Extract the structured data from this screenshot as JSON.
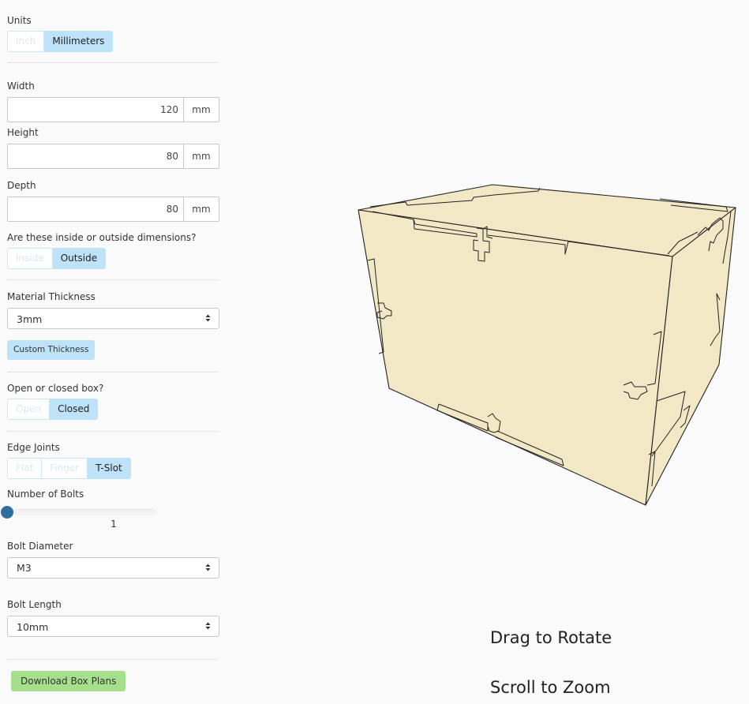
{
  "units": {
    "label": "Units",
    "options": [
      "Inch",
      "Millimeters"
    ],
    "selected": "Millimeters"
  },
  "width": {
    "label": "Width",
    "value": "120",
    "unit": "mm"
  },
  "height": {
    "label": "Height",
    "value": "80",
    "unit": "mm"
  },
  "depth": {
    "label": "Depth",
    "value": "80",
    "unit": "mm"
  },
  "dimensions_mode": {
    "label": "Are these inside or outside dimensions?",
    "options": [
      "Inside",
      "Outside"
    ],
    "selected": "Outside"
  },
  "material_thickness": {
    "label": "Material Thickness",
    "value": "3mm",
    "custom_button": "Custom Thickness"
  },
  "box_open": {
    "label": "Open or closed box?",
    "options": [
      "Open",
      "Closed"
    ],
    "selected": "Closed"
  },
  "edge_joints": {
    "label": "Edge Joints",
    "options": [
      "Flat",
      "Finger",
      "T-Slot"
    ],
    "selected": "T-Slot"
  },
  "bolts": {
    "label": "Number of Bolts",
    "value": "1",
    "slider_fraction": 0.0
  },
  "bolt_diameter": {
    "label": "Bolt Diameter",
    "value": "M3"
  },
  "bolt_length": {
    "label": "Bolt Length",
    "value": "10mm"
  },
  "download_button": "Download Box Plans",
  "hints": {
    "rotate": "Drag to Rotate",
    "zoom": "Scroll to Zoom"
  },
  "colors": {
    "accent": "#bee2f7",
    "download": "#a7e08c",
    "slider_knob": "#2f6f9f",
    "wood": "#f3e8c6"
  }
}
